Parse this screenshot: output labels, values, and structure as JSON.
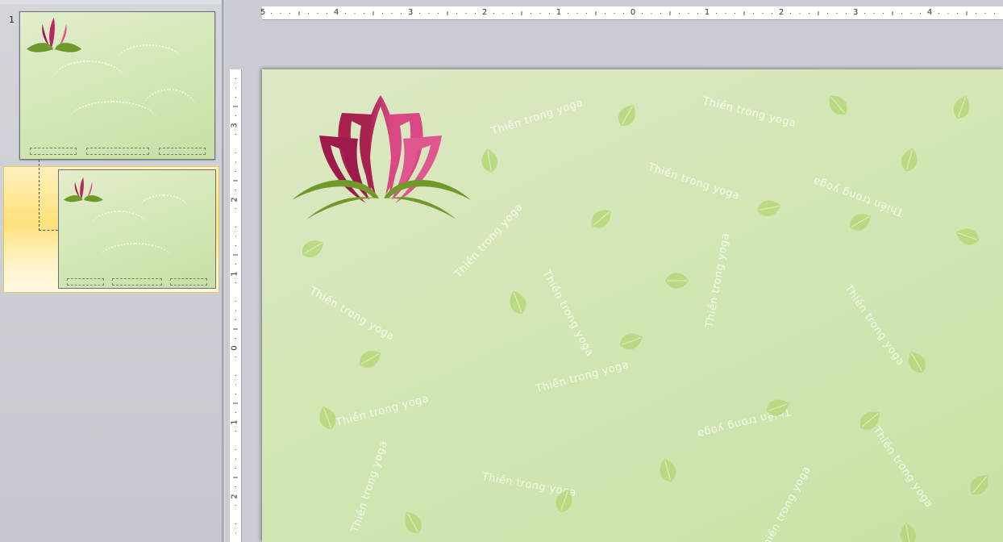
{
  "thumbnails": {
    "slide_number": "1"
  },
  "ruler": {
    "horizontal_labels": [
      "5",
      "4",
      "3",
      "2",
      "1",
      "0",
      "1",
      "2",
      "3",
      "4"
    ],
    "vertical_labels": [
      "3",
      "2",
      "1",
      "0",
      "1",
      "2"
    ]
  },
  "slide": {
    "watermark_text": "Thiền trong yoga",
    "colors": {
      "background": "#d3e6b4",
      "lotus_dark": "#9e1a4c",
      "lotus_light": "#e0568f",
      "leaf_green": "#6f9a2b"
    },
    "icons": [
      "lotus-logo-icon",
      "lotus-leaf-icon"
    ]
  }
}
